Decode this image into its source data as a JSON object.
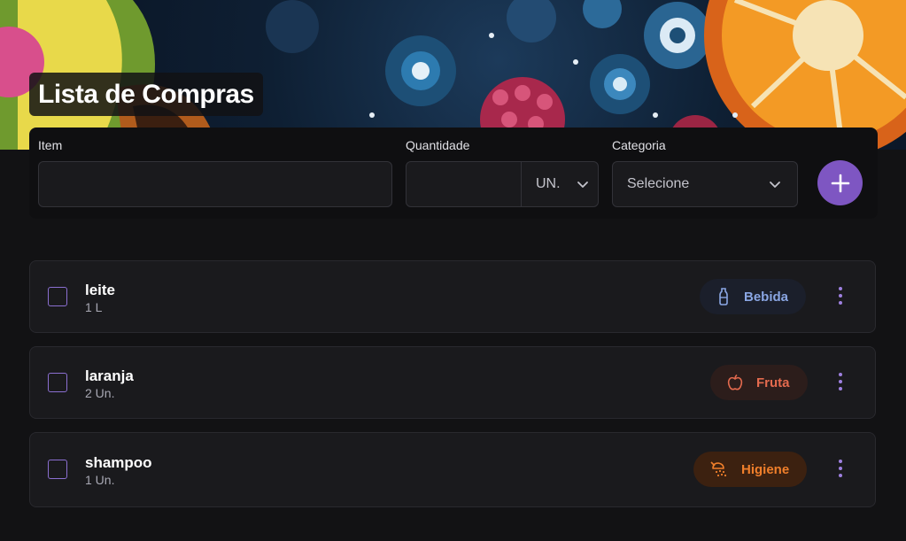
{
  "header": {
    "title": "Lista de Compras"
  },
  "form": {
    "item_label": "Item",
    "item_value": "",
    "quantity_label": "Quantidade",
    "quantity_value": "",
    "unit_selected": "UN.",
    "category_label": "Categoria",
    "category_selected": "Selecione",
    "add_icon": "plus-icon"
  },
  "items": [
    {
      "name": "leite",
      "quantity": "1 L",
      "category": "Bebida",
      "icon": "bottle-icon",
      "badge_bg": "#1b1f2b",
      "badge_fg": "#8aa6e3",
      "checked": false
    },
    {
      "name": "laranja",
      "quantity": "2 Un.",
      "category": "Fruta",
      "icon": "apple-icon",
      "badge_bg": "#2c1d1b",
      "badge_fg": "#e36a4e",
      "checked": false
    },
    {
      "name": "shampoo",
      "quantity": "1 Un.",
      "category": "Higiene",
      "icon": "shower-icon",
      "badge_bg": "#3c2110",
      "badge_fg": "#f07f2b",
      "checked": false
    }
  ],
  "colors": {
    "accent": "#7e56c2",
    "background": "#121214",
    "card": "#1a1a1d"
  }
}
